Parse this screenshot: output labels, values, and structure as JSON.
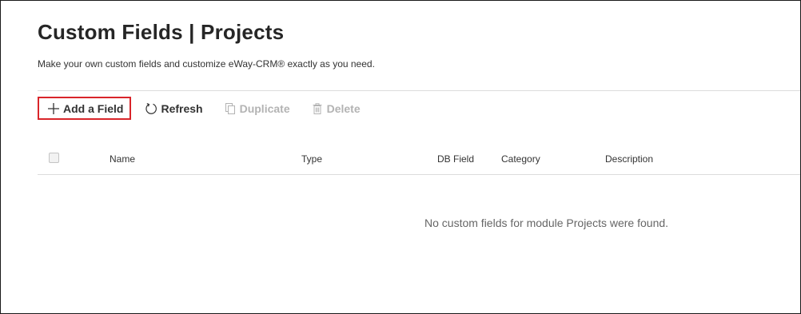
{
  "page": {
    "title": "Custom Fields | Projects",
    "subtitle": "Make your own custom fields and customize eWay-CRM® exactly as you need."
  },
  "toolbar": {
    "add_label": "Add a Field",
    "add_icon": "plus-icon",
    "refresh_label": "Refresh",
    "refresh_icon": "refresh-icon",
    "duplicate_label": "Duplicate",
    "duplicate_icon": "duplicate-icon",
    "delete_label": "Delete",
    "delete_icon": "trash-icon",
    "highlight_color": "#d9252a",
    "disabled_color": "#b3b3b3"
  },
  "table": {
    "columns": [
      "Name",
      "Type",
      "DB Field",
      "Category",
      "Description"
    ],
    "rows": [],
    "empty_message": "No custom fields for module Projects were found."
  }
}
